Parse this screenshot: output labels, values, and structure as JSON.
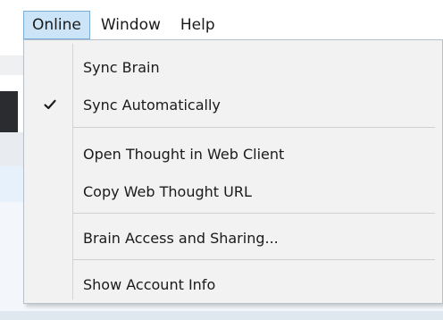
{
  "menubar": {
    "items": [
      {
        "label": "Online",
        "active": true
      },
      {
        "label": "Window",
        "active": false
      },
      {
        "label": "Help",
        "active": false
      }
    ]
  },
  "online_menu": {
    "items": [
      {
        "label": "Sync Brain",
        "checked": false
      },
      {
        "label": "Sync Automatically",
        "checked": true
      },
      {
        "label": "Open Thought in Web Client",
        "checked": false
      },
      {
        "label": "Copy Web Thought URL",
        "checked": false
      },
      {
        "label": "Brain Access and Sharing...",
        "checked": false
      },
      {
        "label": "Show Account Info",
        "checked": false
      }
    ],
    "check_icon": "checkmark-icon"
  },
  "colors": {
    "menu_background": "#f2f2f2",
    "active_menubar_background": "#cce4f7",
    "active_menubar_border": "#7aaed8",
    "text": "#1a1a1a"
  }
}
